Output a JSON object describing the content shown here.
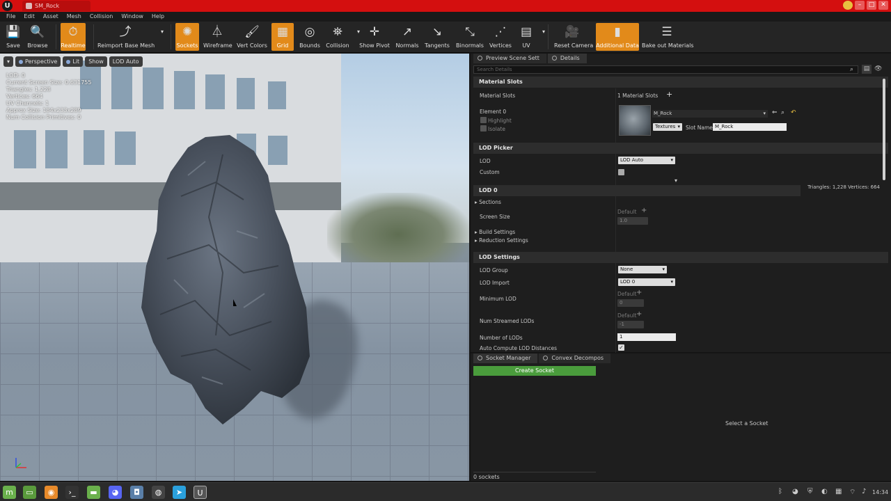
{
  "window": {
    "tab_title": "SM_Rock",
    "logo": "U"
  },
  "menu": [
    "File",
    "Edit",
    "Asset",
    "Mesh",
    "Collision",
    "Window",
    "Help"
  ],
  "toolbar": {
    "save": "Save",
    "browse": "Browse",
    "realtime": "Realtime",
    "reimport": "Reimport Base Mesh",
    "sockets": "Sockets",
    "wireframe": "Wireframe",
    "vert_colors": "Vert Colors",
    "grid": "Grid",
    "bounds": "Bounds",
    "collision": "Collision",
    "show_pivot": "Show Pivot",
    "normals": "Normals",
    "tangents": "Tangents",
    "binormals": "Binormals",
    "vertices": "Vertices",
    "uv": "UV",
    "reset_camera": "Reset Camera",
    "additional_data": "Additional Data",
    "bake_out": "Bake out Materials"
  },
  "viewport": {
    "perspective": "Perspective",
    "lit": "Lit",
    "show": "Show",
    "lod_auto": "LOD Auto",
    "stats": [
      "LOD:  0",
      "Current Screen Size:  0.631755",
      "Triangles:  1,228",
      "Vertices:  664",
      "UV Channels:  1",
      "Approx Size: 184x233x289",
      "Num Collision Primitives:  0"
    ]
  },
  "panel": {
    "tabs": [
      "Preview Scene Sett",
      "Details"
    ],
    "search_placeholder": "Search Details",
    "material_slots": {
      "header": "Material Slots",
      "label": "Material Slots",
      "value": "1 Material Slots",
      "element": "Element 0",
      "highlight": "Highlight",
      "isolate": "Isolate",
      "material": "M_Rock",
      "textures": "Textures",
      "slot_name_label": "Slot Name",
      "slot_name": "M_Rock"
    },
    "lod_picker": {
      "header": "LOD Picker",
      "lod_label": "LOD",
      "lod_value": "LOD Auto",
      "custom": "Custom",
      "tri_info": "Triangles: 1,228   Vertices: 664"
    },
    "lod0": {
      "header": "LOD 0",
      "sections": "Sections",
      "screen_size": "Screen Size",
      "default": "Default",
      "screen_size_value": "1.0",
      "build": "Build Settings",
      "reduction": "Reduction Settings"
    },
    "lod_settings": {
      "header": "LOD Settings",
      "lod_group": "LOD Group",
      "lod_group_value": "None",
      "lod_import": "LOD Import",
      "lod_import_value": "LOD 0",
      "min_lod": "Minimum LOD",
      "default": "Default",
      "min_lod_value": "0",
      "num_streamed": "Num Streamed LODs",
      "num_streamed_value": "-1",
      "num_lods": "Number of LODs",
      "num_lods_value": "1",
      "auto_compute": "Auto Compute LOD Distances"
    }
  },
  "sockets": {
    "tabs": [
      "Socket Manager",
      "Convex Decompos"
    ],
    "create": "Create Socket",
    "select": "Select a Socket",
    "count": "0 sockets"
  },
  "taskbar": {
    "clock": "14:34"
  }
}
